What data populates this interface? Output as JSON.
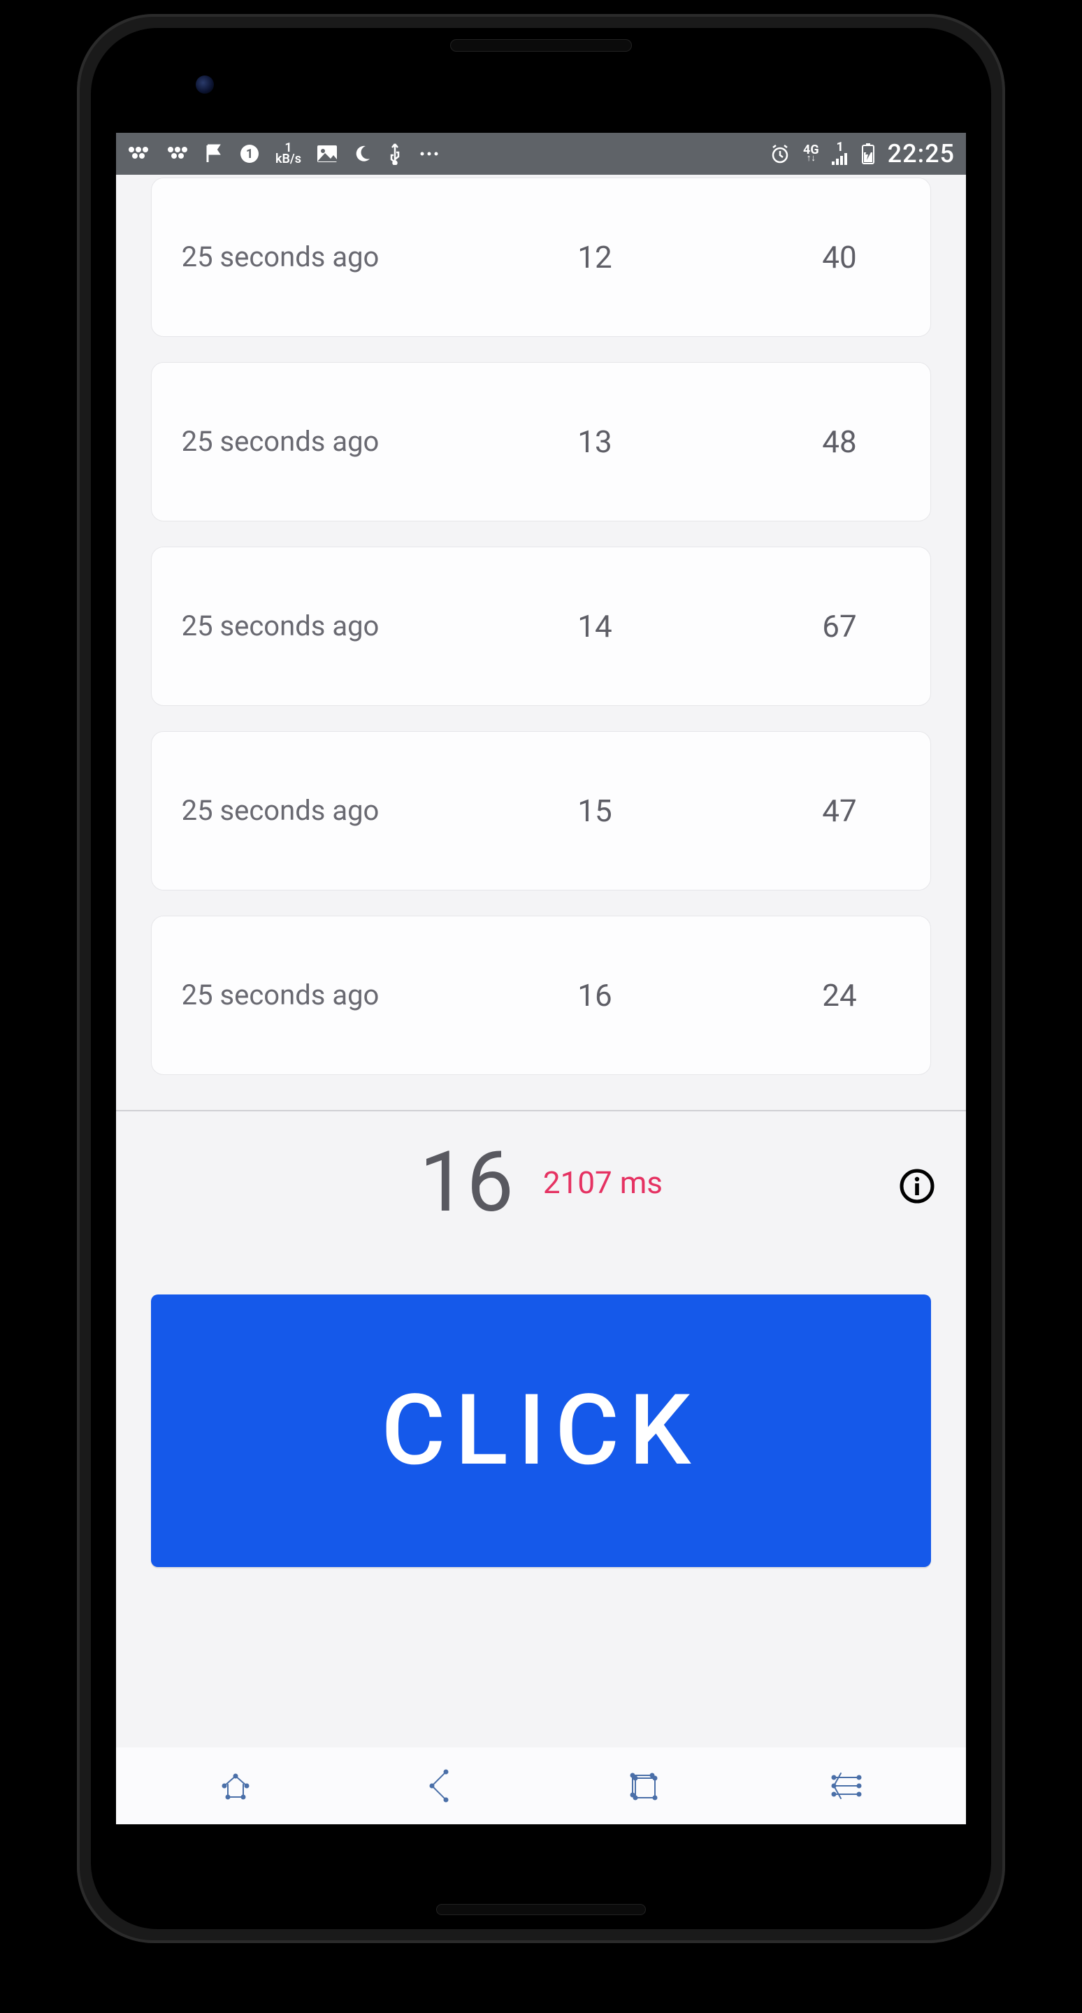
{
  "statusbar": {
    "kbs_top": "1",
    "kbs_bottom": "kB/s",
    "hg_top": "4G",
    "hg_bottom": "1",
    "clock": "22:25"
  },
  "rows": [
    {
      "ago": "25 seconds ago",
      "col2": "12",
      "col3": "40"
    },
    {
      "ago": "25 seconds ago",
      "col2": "13",
      "col3": "48"
    },
    {
      "ago": "25 seconds ago",
      "col2": "14",
      "col3": "67"
    },
    {
      "ago": "25 seconds ago",
      "col2": "15",
      "col3": "47"
    },
    {
      "ago": "25 seconds ago",
      "col2": "16",
      "col3": "24"
    }
  ],
  "summary": {
    "count": "16",
    "latency": "2107 ms"
  },
  "click_button_label": "CLICK"
}
